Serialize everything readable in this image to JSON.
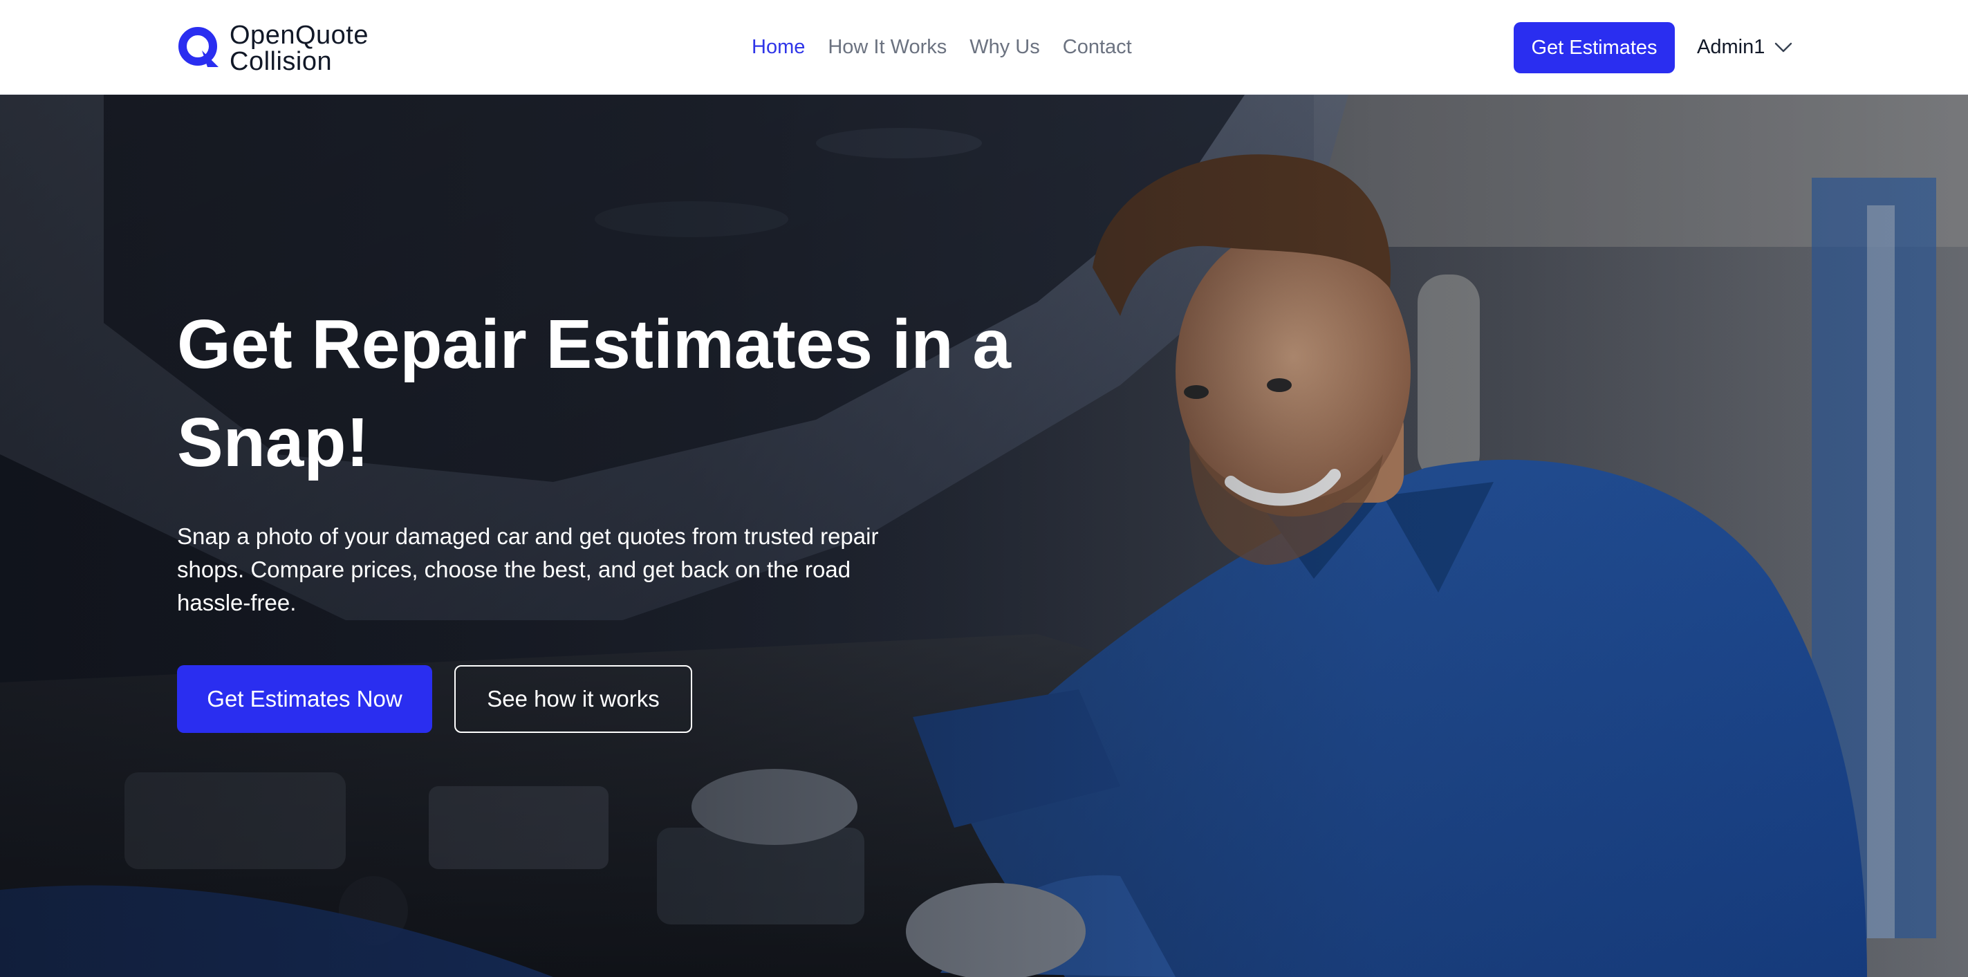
{
  "brand": {
    "name_line1": "OpenQuote",
    "name_line2": "Collision",
    "logo_icon": "q-logo-icon",
    "accent_color": "#2a2ef0"
  },
  "nav": {
    "items": [
      {
        "label": "Home",
        "active": true
      },
      {
        "label": "How It Works",
        "active": false
      },
      {
        "label": "Why Us",
        "active": false
      },
      {
        "label": "Contact",
        "active": false
      }
    ]
  },
  "header": {
    "cta_label": "Get Estimates",
    "user_name": "Admin1",
    "user_menu_icon": "chevron-down-icon"
  },
  "hero": {
    "title": "Get Repair Estimates in a Snap!",
    "subtitle": "Snap a photo of your damaged car and get quotes from trusted repair shops. Compare prices, choose the best, and get back on the road hassle-free.",
    "primary_cta": "Get Estimates Now",
    "secondary_cta": "See how it works"
  }
}
